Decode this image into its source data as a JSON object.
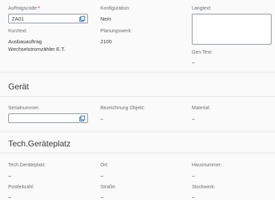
{
  "order": {
    "auftragscode": {
      "label": "Auftragscode:",
      "required": "*",
      "value": "ZA01"
    },
    "konfiguration": {
      "label": "Konfiguration:",
      "value": "Nein"
    },
    "langtext": {
      "label": "Langtext:",
      "value": ""
    },
    "kurztext": {
      "label": "Kurztext:",
      "line1": "Ausbauauftrag",
      "line2": "Wechselstromzähler E.T."
    },
    "planungswerk": {
      "label": "Planungswerk:",
      "value": "2100"
    },
    "gen_text": {
      "label": "Gen.Text:",
      "value": "–"
    }
  },
  "geraet": {
    "title": "Gerät",
    "serialnummer": {
      "label": "Serialnummer:",
      "value": ""
    },
    "bezeichnung": {
      "label": "Bezeichnung Objekt:",
      "value": "–"
    },
    "material": {
      "label": "Material:",
      "value": "–"
    }
  },
  "techplatz": {
    "title": "Tech.Geräteplatz",
    "tech_geraeteplatz": {
      "label": "Tech.Geräteplatz:",
      "value": "–"
    },
    "ort": {
      "label": "Ort:",
      "value": "–"
    },
    "hausnummer": {
      "label": "Hausnummer:",
      "value": "–"
    },
    "postleitzahl": {
      "label": "Postleitzahl:",
      "value": "–"
    },
    "strasse": {
      "label": "Straße:",
      "value": "–"
    },
    "stockwerk": {
      "label": "Stockwerk:",
      "value": "–"
    }
  },
  "icons": {
    "value_help": "value-help-icon"
  },
  "colors": {
    "required": "#bb0000",
    "label": "#6a6d70",
    "text": "#32363a",
    "border": "#89919a"
  }
}
